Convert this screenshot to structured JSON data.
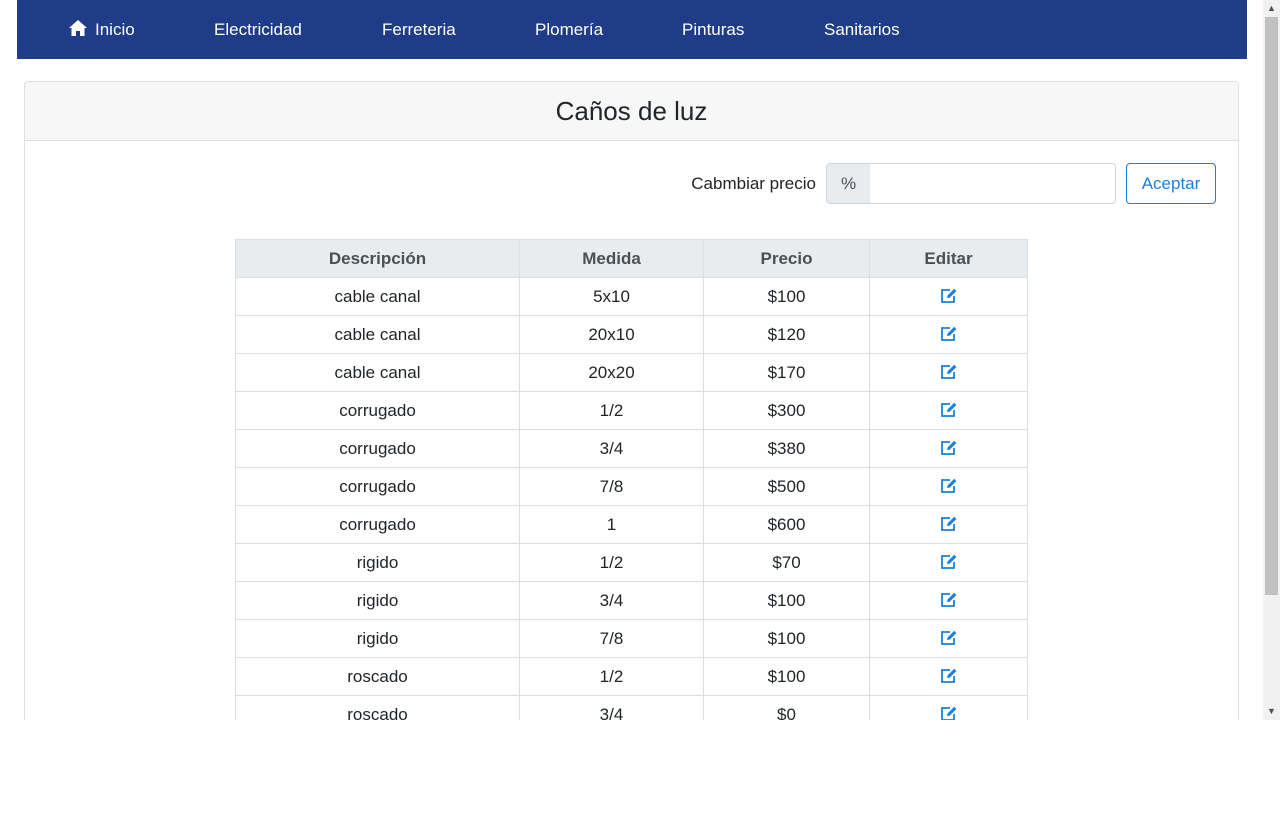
{
  "navbar": {
    "items": [
      {
        "label": "Inicio",
        "icon": "home-icon"
      },
      {
        "label": "Electricidad"
      },
      {
        "label": "Ferreteria"
      },
      {
        "label": "Plomería"
      },
      {
        "label": "Pinturas"
      },
      {
        "label": "Sanitarios"
      }
    ],
    "background": "#1f3c88"
  },
  "card": {
    "title": "Caños de luz"
  },
  "price_change": {
    "label": "Cabmbiar precio",
    "prefix": "%",
    "value": "",
    "accept_label": "Aceptar"
  },
  "table": {
    "headers": [
      "Descripción",
      "Medida",
      "Precio",
      "Editar"
    ],
    "rows": [
      {
        "descripcion": "cable canal",
        "medida": "5x10",
        "precio": "$100"
      },
      {
        "descripcion": "cable canal",
        "medida": "20x10",
        "precio": "$120"
      },
      {
        "descripcion": "cable canal",
        "medida": "20x20",
        "precio": "$170"
      },
      {
        "descripcion": "corrugado",
        "medida": "1/2",
        "precio": "$300"
      },
      {
        "descripcion": "corrugado",
        "medida": "3/4",
        "precio": "$380"
      },
      {
        "descripcion": "corrugado",
        "medida": "7/8",
        "precio": "$500"
      },
      {
        "descripcion": "corrugado",
        "medida": "1",
        "precio": "$600"
      },
      {
        "descripcion": "rigido",
        "medida": "1/2",
        "precio": "$70"
      },
      {
        "descripcion": "rigido",
        "medida": "3/4",
        "precio": "$100"
      },
      {
        "descripcion": "rigido",
        "medida": "7/8",
        "precio": "$100"
      },
      {
        "descripcion": "roscado",
        "medida": "1/2",
        "precio": "$100"
      },
      {
        "descripcion": "roscado",
        "medida": "3/4",
        "precio": "$0"
      }
    ],
    "edit_icon": "edit-icon"
  },
  "colors": {
    "accent": "#1e7fd9",
    "header_bg": "#e9ecef"
  }
}
